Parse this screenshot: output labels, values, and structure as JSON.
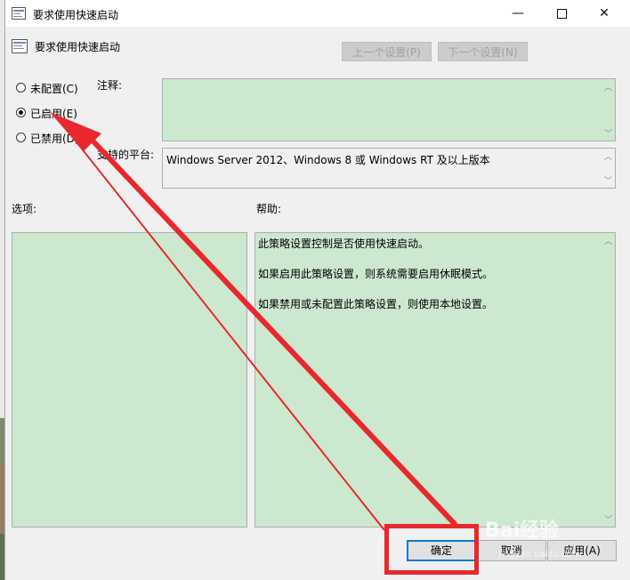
{
  "window": {
    "title": "要求使用快速启动",
    "buttons": {
      "minimize": "—",
      "close": "✕"
    }
  },
  "header": {
    "title": "要求使用快速启动",
    "prev_button": "上一个设置(P)",
    "next_button": "下一个设置(N)"
  },
  "state": {
    "options": [
      {
        "label": "未配置(C)",
        "selected": false
      },
      {
        "label": "已启用(E)",
        "selected": true
      },
      {
        "label": "已禁用(D)",
        "selected": false
      }
    ]
  },
  "comment": {
    "label": "注释:",
    "value": ""
  },
  "platform": {
    "label": "支持的平台:",
    "value": "Windows Server 2012、Windows 8 或 Windows RT 及以上版本"
  },
  "options_section": {
    "label": "选项:"
  },
  "help_section": {
    "label": "帮助:",
    "paragraphs": [
      "此策略设置控制是否使用快速启动。",
      "如果启用此策略设置，则系统需要启用休眠模式。",
      "如果禁用或未配置此策略设置，则使用本地设置。"
    ]
  },
  "footer": {
    "ok": "确定",
    "cancel": "取消",
    "apply": "应用(A)"
  },
  "annotation": {
    "color": "#e8282c"
  },
  "watermark": {
    "text": "Bai经验",
    "sub": "jingyan.baidu.com"
  }
}
